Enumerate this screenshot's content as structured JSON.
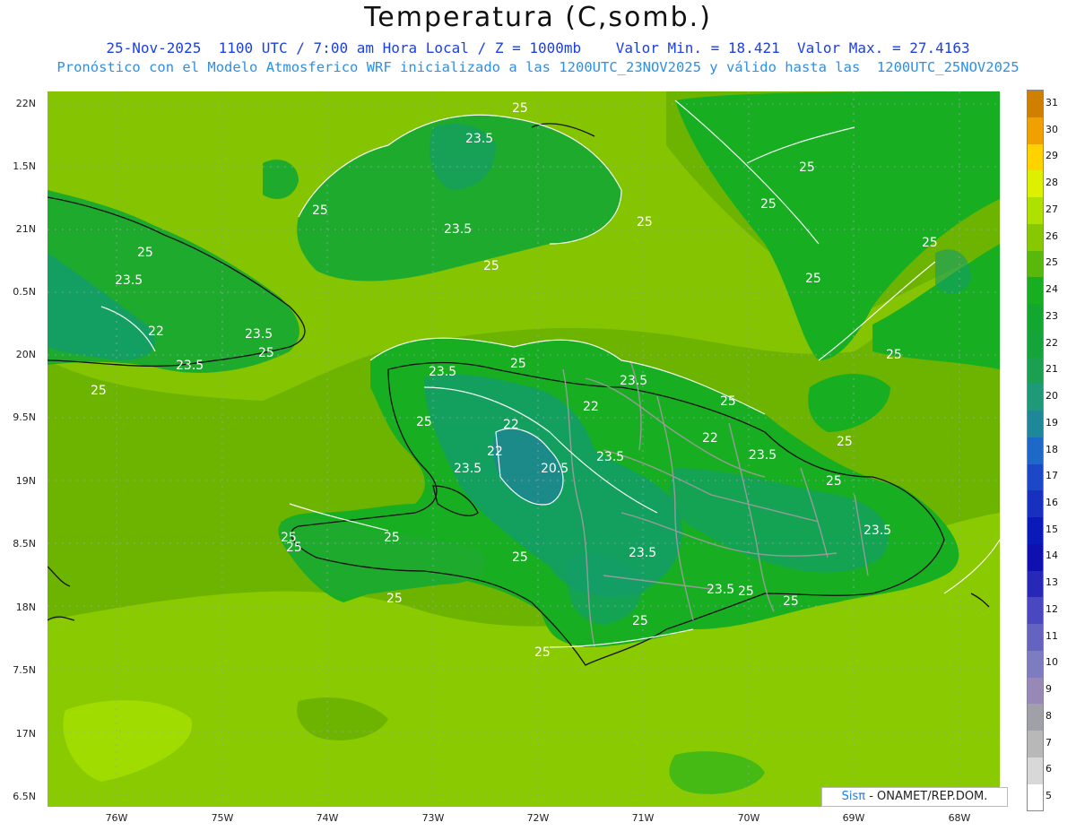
{
  "title": "Temperatura (C,somb.)",
  "subtitle_line1": "25-Nov-2025  1100 UTC / 7:00 am Hora Local / Z = 1000mb    Valor Min. = 18.421  Valor Max. = 27.4163",
  "subtitle_line2": "Pronóstico con el Modelo Atmosferico WRF inicializado a las 1200UTC_23NOV2025 y válido hasta las  1200UTC_25NOV2025",
  "lat_labels": [
    "22N",
    "1.5N",
    "21N",
    "0.5N",
    "20N",
    "9.5N",
    "19N",
    "8.5N",
    "18N",
    "7.5N",
    "17N",
    "6.5N"
  ],
  "lon_labels": [
    "76W",
    "75W",
    "74W",
    "73W",
    "72W",
    "71W",
    "70W",
    "69W",
    "68W"
  ],
  "colorbar": {
    "levels": [
      "5",
      "6",
      "7",
      "8",
      "9",
      "10",
      "11",
      "12",
      "13",
      "14",
      "15",
      "16",
      "17",
      "18",
      "19",
      "20",
      "21",
      "22",
      "23",
      "24",
      "25",
      "26",
      "27",
      "28",
      "29",
      "30",
      "31"
    ],
    "colors": [
      "#ffffff",
      "#d8d8d8",
      "#b8b8b8",
      "#a0a0a8",
      "#9888b8",
      "#7e7cc0",
      "#6464c0",
      "#4a48c0",
      "#2828b8",
      "#1010b0",
      "#0a1ab8",
      "#1830c0",
      "#1c48c8",
      "#1e68c8",
      "#1e8898",
      "#1e9a78",
      "#1aa050",
      "#14a43a",
      "#12a830",
      "#18ae22",
      "#58b80c",
      "#88c800",
      "#aee000",
      "#dcf000",
      "#ffd200",
      "#f0a000",
      "#d08000"
    ]
  },
  "contour_labels": {
    "cuba": [
      "23.5",
      "22",
      "23.5",
      "23.5",
      "25",
      "25",
      "25"
    ],
    "bahamas": [
      "25",
      "23.5",
      "23.5",
      "25",
      "25",
      "25"
    ],
    "atlantic": [
      "25",
      "25",
      "25",
      "25",
      "25"
    ],
    "haiti_north": [
      "25",
      "23.5",
      "25",
      "22",
      "22",
      "23.5"
    ],
    "hispaniola_center": [
      "22",
      "20.5",
      "23.5",
      "23.5",
      "25",
      "22",
      "23.5",
      "25"
    ],
    "hispaniola_east": [
      "25",
      "23.5",
      "25",
      "23.5",
      "23.5",
      "25"
    ],
    "tiburon": [
      "25",
      "25",
      "25",
      "25",
      "25"
    ],
    "south": [
      "25",
      "25"
    ]
  },
  "credit": {
    "brand": "Sisπ",
    "rest": " - ONAMET/REP.DOM."
  }
}
